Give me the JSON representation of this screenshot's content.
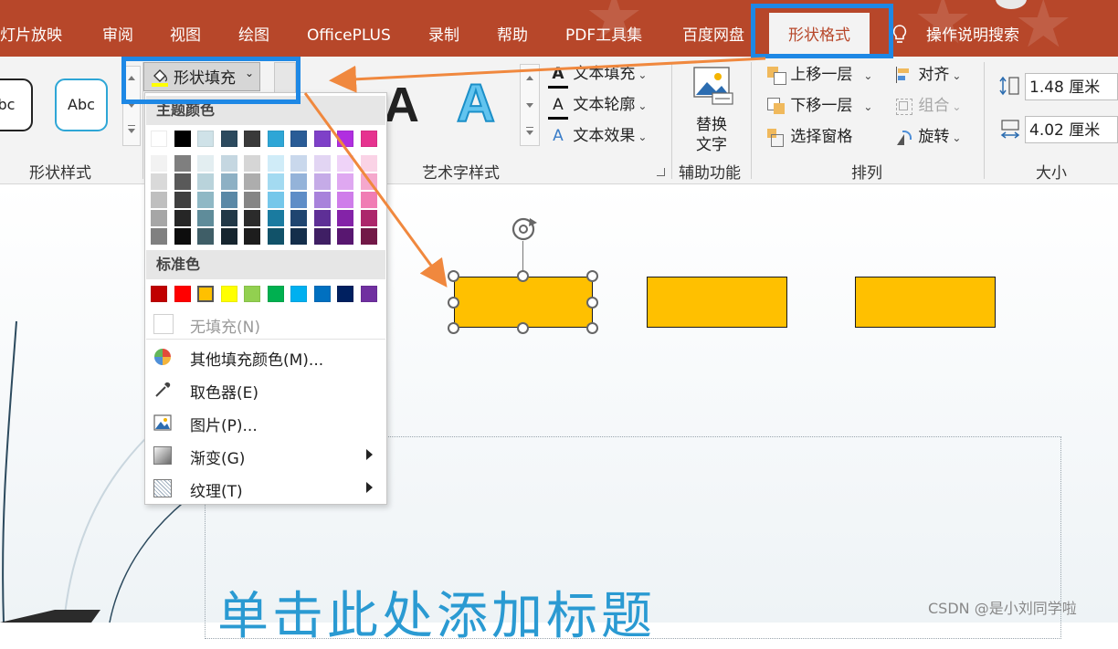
{
  "tabs": [
    "灯片放映",
    "审阅",
    "视图",
    "绘图",
    "OfficePLUS",
    "录制",
    "帮助",
    "PDF工具集",
    "百度网盘"
  ],
  "active_tab": "形状格式",
  "tell_me": "操作说明搜索",
  "ribbon": {
    "shape_styles": {
      "tile1": "bc",
      "tile2": "Abc",
      "label": "形状样式"
    },
    "shape_fill_label": "形状填充",
    "wordart": {
      "text_fill": "文本填充",
      "text_outline": "文本轮廓",
      "text_effect": "文本效果",
      "label": "艺术字样式",
      "letter": "A"
    },
    "accessibility": {
      "alt_text_line1": "替换",
      "alt_text_line2": "文字",
      "label": "辅助功能"
    },
    "arrange": {
      "bring_forward": "上移一层",
      "send_backward": "下移一层",
      "selection_pane": "选择窗格",
      "align": "对齐",
      "group": "组合",
      "rotate": "旋转",
      "label": "排列"
    },
    "size": {
      "height": "1.48 厘米",
      "width": "4.02 厘米",
      "label": "大小"
    }
  },
  "dropdown": {
    "theme_colors_header": "主题颜色",
    "theme_top_row": [
      "#ffffff",
      "#000000",
      "#cfe2e8",
      "#2c4a5e",
      "#3a3a3a",
      "#2ea6d6",
      "#2a5c96",
      "#7e40c8",
      "#b02fe0",
      "#e6338f"
    ],
    "theme_shades": [
      [
        "#f2f2f2",
        "#7f7f7f",
        "#e3eef1",
        "#c5d7e1",
        "#d6d6d6",
        "#d0ecf8",
        "#c9d8ec",
        "#e2d5f3",
        "#efd3f8",
        "#fad3e6"
      ],
      [
        "#d9d9d9",
        "#595959",
        "#b9d3db",
        "#8db0c4",
        "#adadad",
        "#a3daf1",
        "#94b3d9",
        "#c5abe7",
        "#dfa8f1",
        "#f5a8cd"
      ],
      [
        "#bfbfbf",
        "#3f3f3f",
        "#8fb8c5",
        "#5a88a6",
        "#858585",
        "#75c7ea",
        "#5e8dc7",
        "#a882db",
        "#cf7dea",
        "#f07db4"
      ],
      [
        "#a6a6a6",
        "#262626",
        "#5f8c9a",
        "#213847",
        "#2b2b2b",
        "#1a7ba0",
        "#1f4570",
        "#5e2f96",
        "#8423a8",
        "#ac266b"
      ],
      [
        "#808080",
        "#0d0d0d",
        "#3f5e67",
        "#16252f",
        "#1d1d1d",
        "#115269",
        "#142e4b",
        "#3f1f64",
        "#581770",
        "#721947"
      ]
    ],
    "standard_header": "标准色",
    "standard_colors": [
      "#c00000",
      "#ff0000",
      "#ffc000",
      "#ffff00",
      "#92d050",
      "#00b050",
      "#00b0f0",
      "#0070c0",
      "#002060",
      "#7030a0"
    ],
    "no_fill": "无填充(N)",
    "more_colors": "其他填充颜色(M)...",
    "eyedropper": "取色器(E)",
    "picture": "图片(P)...",
    "gradient": "渐变(G)",
    "texture": "纹理(T)"
  },
  "slide": {
    "title": "单击此处添加标题"
  },
  "watermark": "CSDN @是小刘同学啦"
}
